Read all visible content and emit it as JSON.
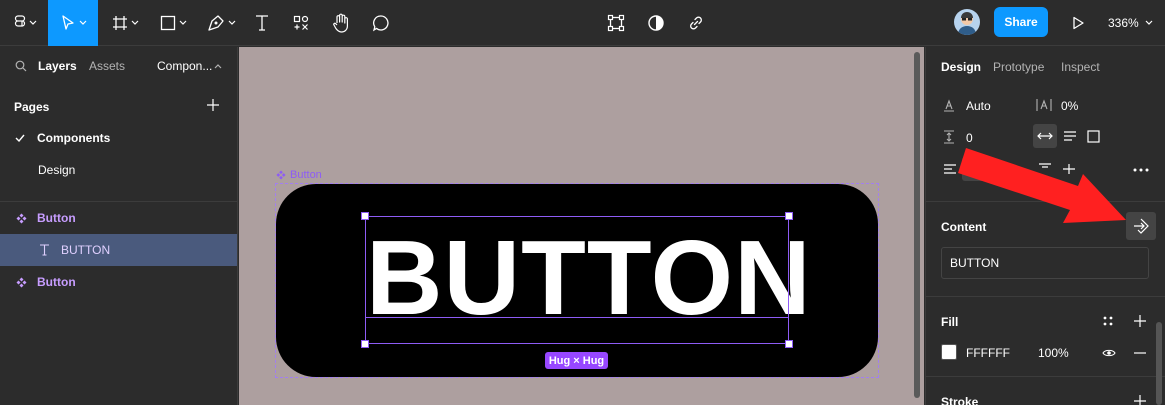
{
  "toolbar": {
    "share_label": "Share",
    "zoom_label": "336%"
  },
  "left_panel": {
    "tabs": [
      "Layers",
      "Assets",
      "Compon..."
    ],
    "pages_title": "Pages",
    "pages": [
      {
        "label": "Components",
        "current": true
      },
      {
        "label": "Design",
        "current": false
      }
    ],
    "layers": [
      {
        "label": "Button",
        "type": "component"
      },
      {
        "label": "BUTTON",
        "type": "text",
        "selected": true
      },
      {
        "label": "Button",
        "type": "component"
      }
    ]
  },
  "canvas": {
    "frame_label": "Button",
    "button_text": "BUTTON",
    "hug_tag": "Hug × Hug"
  },
  "right_panel": {
    "tabs": [
      "Design",
      "Prototype",
      "Inspect"
    ],
    "line_height": "Auto",
    "letter_spacing": "0%",
    "paragraph_spacing": "0",
    "content_title": "Content",
    "content_value": "BUTTON",
    "fill_title": "Fill",
    "fill_hex": "FFFFFF",
    "fill_opacity": "100%",
    "stroke_title": "Stroke"
  },
  "colors": {
    "accent": "#0d99ff",
    "component_purple": "#9747ff",
    "annotation_arrow": "#ff2020",
    "canvas_bg": "#ad9f9f"
  }
}
